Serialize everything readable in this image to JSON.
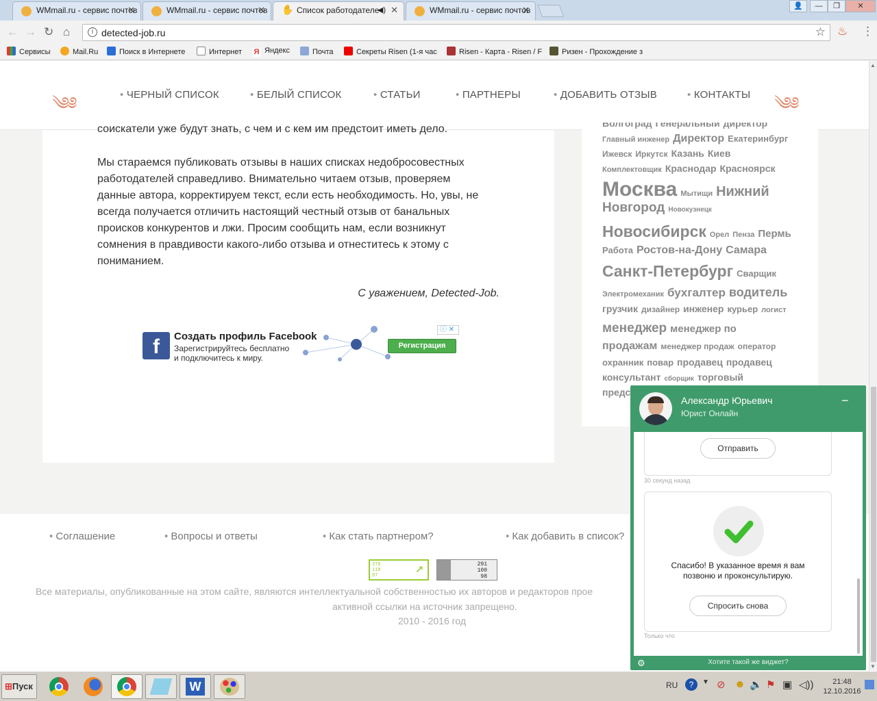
{
  "browser": {
    "tabs": [
      {
        "title": "WMmail.ru - сервис почтов",
        "active": false
      },
      {
        "title": "WMmail.ru - сервис почтов",
        "active": false
      },
      {
        "title": "Список работодателе",
        "active": true
      },
      {
        "title": "WMmail.ru - сервис почтов",
        "active": false
      }
    ],
    "url": "detected-job.ru",
    "bookmarks": [
      "Сервисы",
      "Mail.Ru",
      "Поиск в Интернете",
      "Интернет",
      "Яндекс",
      "Почта",
      "Секреты Risen (1-я час",
      "Risen - Карта - Risen / F",
      "Ризен - Прохождение з"
    ]
  },
  "nav": {
    "items": [
      "ЧЕРНЫЙ СПИСОК",
      "БЕЛЫЙ СПИСОК",
      "СТАТЬИ",
      "ПАРТНЕРЫ",
      "ДОБАВИТЬ ОТЗЫВ",
      "КОНТАКТЫ"
    ]
  },
  "article": {
    "partial_line": "соискатели уже будут знать, с чем и с кем им предстоит иметь дело.",
    "paragraph": [
      "Мы стараемся публиковать отзывы в наших списках недобросовестных",
      "работодателей справедливо. Внимательно читаем отзыв, проверяем",
      "данные автора, корректируем текст, если есть необходимость. Но, увы, не",
      "всегда получается отличить настоящий честный отзыв от банальных",
      "происков конкурентов и лжи. Просим сообщить нам, если возникнут",
      "сомнения в правдивости какого-либо отзыва и отнеститесь к этому с",
      "пониманием."
    ],
    "signature": "С уважением, Detected-Job."
  },
  "ad": {
    "title": "Создать профиль Facebook",
    "line1": "Зарегистрируйтесь бесплатно",
    "line2": "и подключитесь к миру.",
    "button": "Регистрация"
  },
  "tag_cloud": [
    [
      "Волгоград",
      "Генеральный",
      "директор"
    ],
    [
      "Главный инженер",
      "Директор",
      "Екатеринбург"
    ],
    [
      "Ижевск",
      "Иркутск",
      "Казань",
      "Киев"
    ],
    [
      "Комплектовщик",
      "Краснодар",
      "Красноярск"
    ],
    [
      "Москва",
      "Мытищи",
      "Нижний"
    ],
    [
      "Новгород",
      "Новокузнецк"
    ],
    [
      "Новосибирск",
      "Орел",
      "Пенза",
      "Пермь"
    ],
    [
      "Работа",
      "Ростов-на-Дону",
      "Самара"
    ],
    [
      "Санкт-Петербург",
      "Сварщик"
    ],
    [
      "Электромеханик",
      "бухгалтер",
      "водитель"
    ],
    [
      "грузчик",
      "дизайнер",
      "инженер",
      "курьер",
      "логист"
    ],
    [
      "менеджер",
      "менеджер по"
    ],
    [
      "продажам",
      "менеджер продаж",
      "оператор"
    ],
    [
      "охранник",
      "повар",
      "продавец",
      "продавец"
    ],
    [
      "консультант",
      "сборщик",
      "торговый"
    ],
    [
      "предс"
    ]
  ],
  "footer": {
    "links": [
      "Соглашение",
      "Вопросы и ответы",
      "Как стать партнером?",
      "Как добавить в список?"
    ],
    "counter1": [
      "378",
      "118",
      "97"
    ],
    "counter2": [
      "291",
      "100",
      "98"
    ],
    "copyright1": "Все материалы, опубликованные на этом сайте, являются интеллектуальной собственностью их авторов и редакторов прое",
    "copyright2": "активной ссылки на источник запрещено.",
    "years": "2010 - 2016 год"
  },
  "chat": {
    "name": "Александр Юрьевич",
    "role": "Юрист Онлайн",
    "minimize": "−",
    "send_button": "Отправить",
    "time1": "30 секунд назад",
    "thanks_line1": "Спасибо! В указанное время я вам",
    "thanks_line2": "позвоню и проконсультирую.",
    "ask_again": "Спросить снова",
    "time2": "Только что",
    "footer_link": "Хотите такой же виджет?"
  },
  "taskbar": {
    "start": "Пуск",
    "lang": "RU",
    "time": "21:48",
    "date": "12.10.2016"
  },
  "colors": {
    "accent": "#e08a6a",
    "chat_green": "#3f9b6b",
    "fb_blue": "#3b5998",
    "fb_green": "#4cae4c"
  }
}
